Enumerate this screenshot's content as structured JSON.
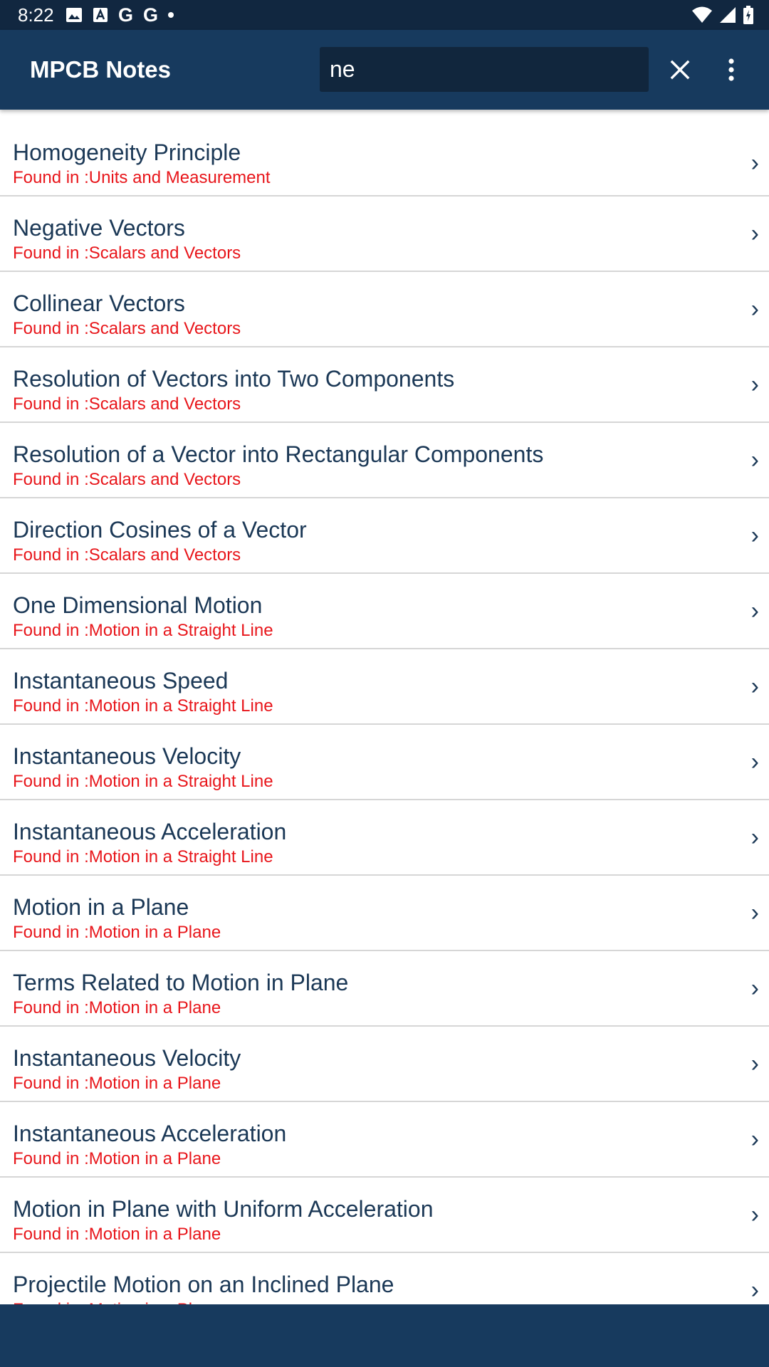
{
  "status_bar": {
    "time": "8:22",
    "left_icons": [
      "image-icon",
      "font-icon",
      "google-icon",
      "google-icon",
      "dot-icon"
    ],
    "google_letter": "G",
    "right_icons": [
      "wifi-icon",
      "signal-icon",
      "battery-icon"
    ]
  },
  "app_bar": {
    "title": "MPCB Notes",
    "search_value": "ne",
    "close_icon": "close-icon",
    "more_icon": "more-vert-icon",
    "background_color": "#173a5e"
  },
  "results": [
    {
      "title": "Homogeneity Principle",
      "found_in": "Found in :Units and Measurement"
    },
    {
      "title": "Negative Vectors",
      "found_in": "Found in :Scalars and Vectors"
    },
    {
      "title": "Collinear Vectors",
      "found_in": "Found in :Scalars and Vectors"
    },
    {
      "title": "Resolution of Vectors into Two Components",
      "found_in": "Found in :Scalars and Vectors"
    },
    {
      "title": "Resolution of a Vector into Rectangular Components",
      "found_in": "Found in :Scalars and Vectors"
    },
    {
      "title": "Direction Cosines of a Vector",
      "found_in": "Found in :Scalars and Vectors"
    },
    {
      "title": "One Dimensional Motion",
      "found_in": "Found in :Motion in a Straight Line"
    },
    {
      "title": "Instantaneous Speed",
      "found_in": "Found in :Motion in a Straight Line"
    },
    {
      "title": "Instantaneous Velocity",
      "found_in": "Found in :Motion in a Straight Line"
    },
    {
      "title": "Instantaneous Acceleration",
      "found_in": "Found in :Motion in a Straight Line"
    },
    {
      "title": "Motion in a Plane",
      "found_in": "Found in :Motion in a Plane"
    },
    {
      "title": "Terms Related to Motion in Plane",
      "found_in": "Found in :Motion in a Plane"
    },
    {
      "title": "Instantaneous Velocity",
      "found_in": "Found in :Motion in a Plane"
    },
    {
      "title": "Instantaneous Acceleration",
      "found_in": "Found in :Motion in a Plane"
    },
    {
      "title": "Motion in Plane with Uniform Acceleration",
      "found_in": "Found in :Motion in a Plane"
    },
    {
      "title": "Projectile Motion on an Inclined Plane",
      "found_in": "Found in :Motion in a Plane"
    }
  ],
  "chevron_glyph": "›",
  "colors": {
    "status_bar": "#112740",
    "title_text": "#1b3856",
    "found_in_text": "#e8161b",
    "divider": "#d6d6d6"
  }
}
